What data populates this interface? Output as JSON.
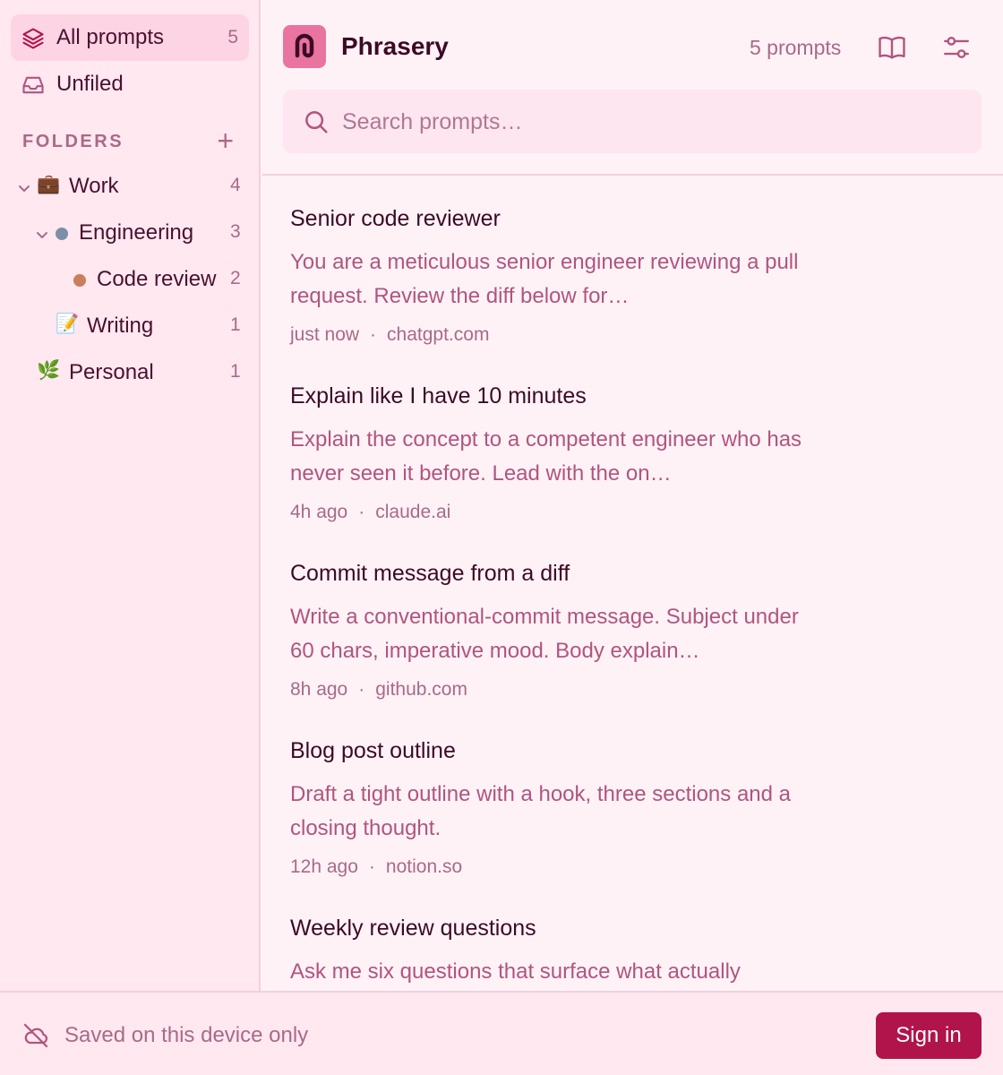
{
  "sidebar": {
    "nav": [
      {
        "label": "All prompts",
        "count": "5",
        "icon": "layers-icon"
      },
      {
        "label": "Unfiled",
        "icon": "inbox-icon"
      }
    ],
    "folders_label": "FOLDERS",
    "add_folder": "+",
    "tree": [
      {
        "label": "Work",
        "count": "4",
        "emoji": "💼"
      },
      {
        "label": "Engineering",
        "count": "3",
        "dot_color": "#7b8fa8"
      },
      {
        "label": "Code review",
        "count": "2",
        "dot_color": "#c97f5c"
      },
      {
        "label": "Writing",
        "count": "1",
        "emoji": "📝"
      },
      {
        "label": "Personal",
        "count": "1",
        "emoji": "🌿"
      }
    ]
  },
  "header": {
    "app_title": "Phrasery",
    "prompt_count": "5 prompts",
    "icons": [
      "book-icon",
      "sliders-icon"
    ]
  },
  "search": {
    "placeholder": "Search prompts…"
  },
  "prompts": [
    {
      "title": "Senior code reviewer",
      "desc": "You are a meticulous senior engineer reviewing a pull request. Review the diff below for…",
      "time": "just now",
      "source": "chatgpt.com"
    },
    {
      "title": "Explain like I have 10 minutes",
      "desc": "Explain the concept to a competent engineer who has never seen it before. Lead with the on…",
      "time": "4h ago",
      "source": "claude.ai"
    },
    {
      "title": "Commit message from a diff",
      "desc": "Write a conventional-commit message. Subject under 60 chars, imperative mood. Body explain…",
      "time": "8h ago",
      "source": "github.com"
    },
    {
      "title": "Blog post outline",
      "desc": "Draft a tight outline with a hook, three sections and a closing thought.",
      "time": "12h ago",
      "source": "notion.so"
    },
    {
      "title": "Weekly review questions",
      "desc": "Ask me six questions that surface what actually",
      "time": "",
      "source": ""
    }
  ],
  "meta_sep": "·",
  "footer": {
    "saved_text": "Saved on this device only",
    "sign_in": "Sign in"
  },
  "colors": {
    "accent": "#b0144a",
    "logo": "#e8749f",
    "sidebar_bg": "#ffe8f0",
    "main_bg": "#fff2f6"
  }
}
